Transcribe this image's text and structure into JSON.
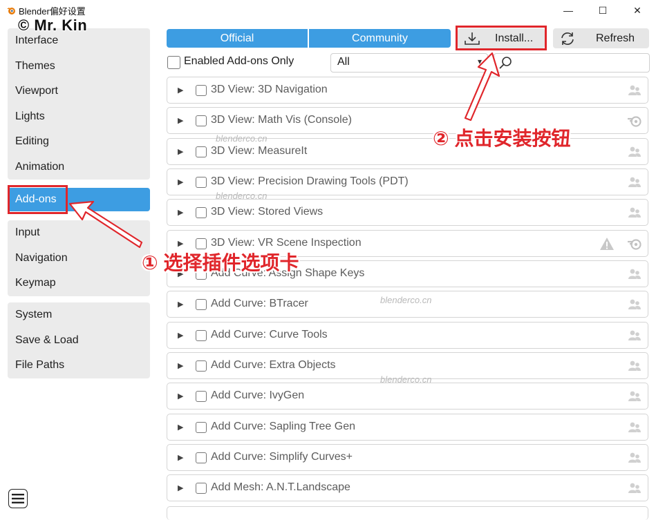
{
  "window": {
    "title": "Blender偏好设置",
    "minimize": "—",
    "maximize": "☐",
    "close": "✕"
  },
  "watermark_author": "© Mr. Kin",
  "sidebar": {
    "groups": [
      [
        "Interface",
        "Themes",
        "Viewport",
        "Lights",
        "Editing",
        "Animation"
      ],
      [
        "Add-ons"
      ],
      [
        "Input",
        "Navigation",
        "Keymap"
      ],
      [
        "System",
        "Save & Load",
        "File Paths"
      ]
    ],
    "active": "Add-ons"
  },
  "tabs": {
    "official": "Official",
    "community": "Community"
  },
  "toolbar": {
    "install": "Install...",
    "refresh": "Refresh"
  },
  "filters": {
    "enabled_only": "Enabled Add-ons Only",
    "category": "All",
    "search_placeholder": ""
  },
  "addons": [
    {
      "name": "3D View: 3D Navigation",
      "icon": "community-users-icon",
      "warning": false
    },
    {
      "name": "3D View: Math Vis (Console)",
      "icon": "blender-official-icon",
      "warning": false
    },
    {
      "name": "3D View: MeasureIt",
      "icon": "community-users-icon",
      "warning": false
    },
    {
      "name": "3D View: Precision Drawing Tools (PDT)",
      "icon": "community-users-icon",
      "warning": false
    },
    {
      "name": "3D View: Stored Views",
      "icon": "community-users-icon",
      "warning": false
    },
    {
      "name": "3D View: VR Scene Inspection",
      "icon": "blender-official-icon",
      "warning": true
    },
    {
      "name": "Add Curve: Assign Shape Keys",
      "icon": "community-users-icon",
      "warning": false
    },
    {
      "name": "Add Curve: BTracer",
      "icon": "community-users-icon",
      "warning": false
    },
    {
      "name": "Add Curve: Curve Tools",
      "icon": "community-users-icon",
      "warning": false
    },
    {
      "name": "Add Curve: Extra Objects",
      "icon": "community-users-icon",
      "warning": false
    },
    {
      "name": "Add Curve: IvyGen",
      "icon": "community-users-icon",
      "warning": false
    },
    {
      "name": "Add Curve: Sapling Tree Gen",
      "icon": "community-users-icon",
      "warning": false
    },
    {
      "name": "Add Curve: Simplify Curves+",
      "icon": "community-users-icon",
      "warning": false
    },
    {
      "name": "Add Mesh: A.N.T.Landscape",
      "icon": "community-users-icon",
      "warning": false
    }
  ],
  "annotations": {
    "step1": "① 选择插件选项卡",
    "step2": "② 点击安装按钮"
  },
  "site_watermark": "blenderco.cn",
  "colors": {
    "accent": "#3d9de2",
    "annotation": "#e0262b"
  }
}
